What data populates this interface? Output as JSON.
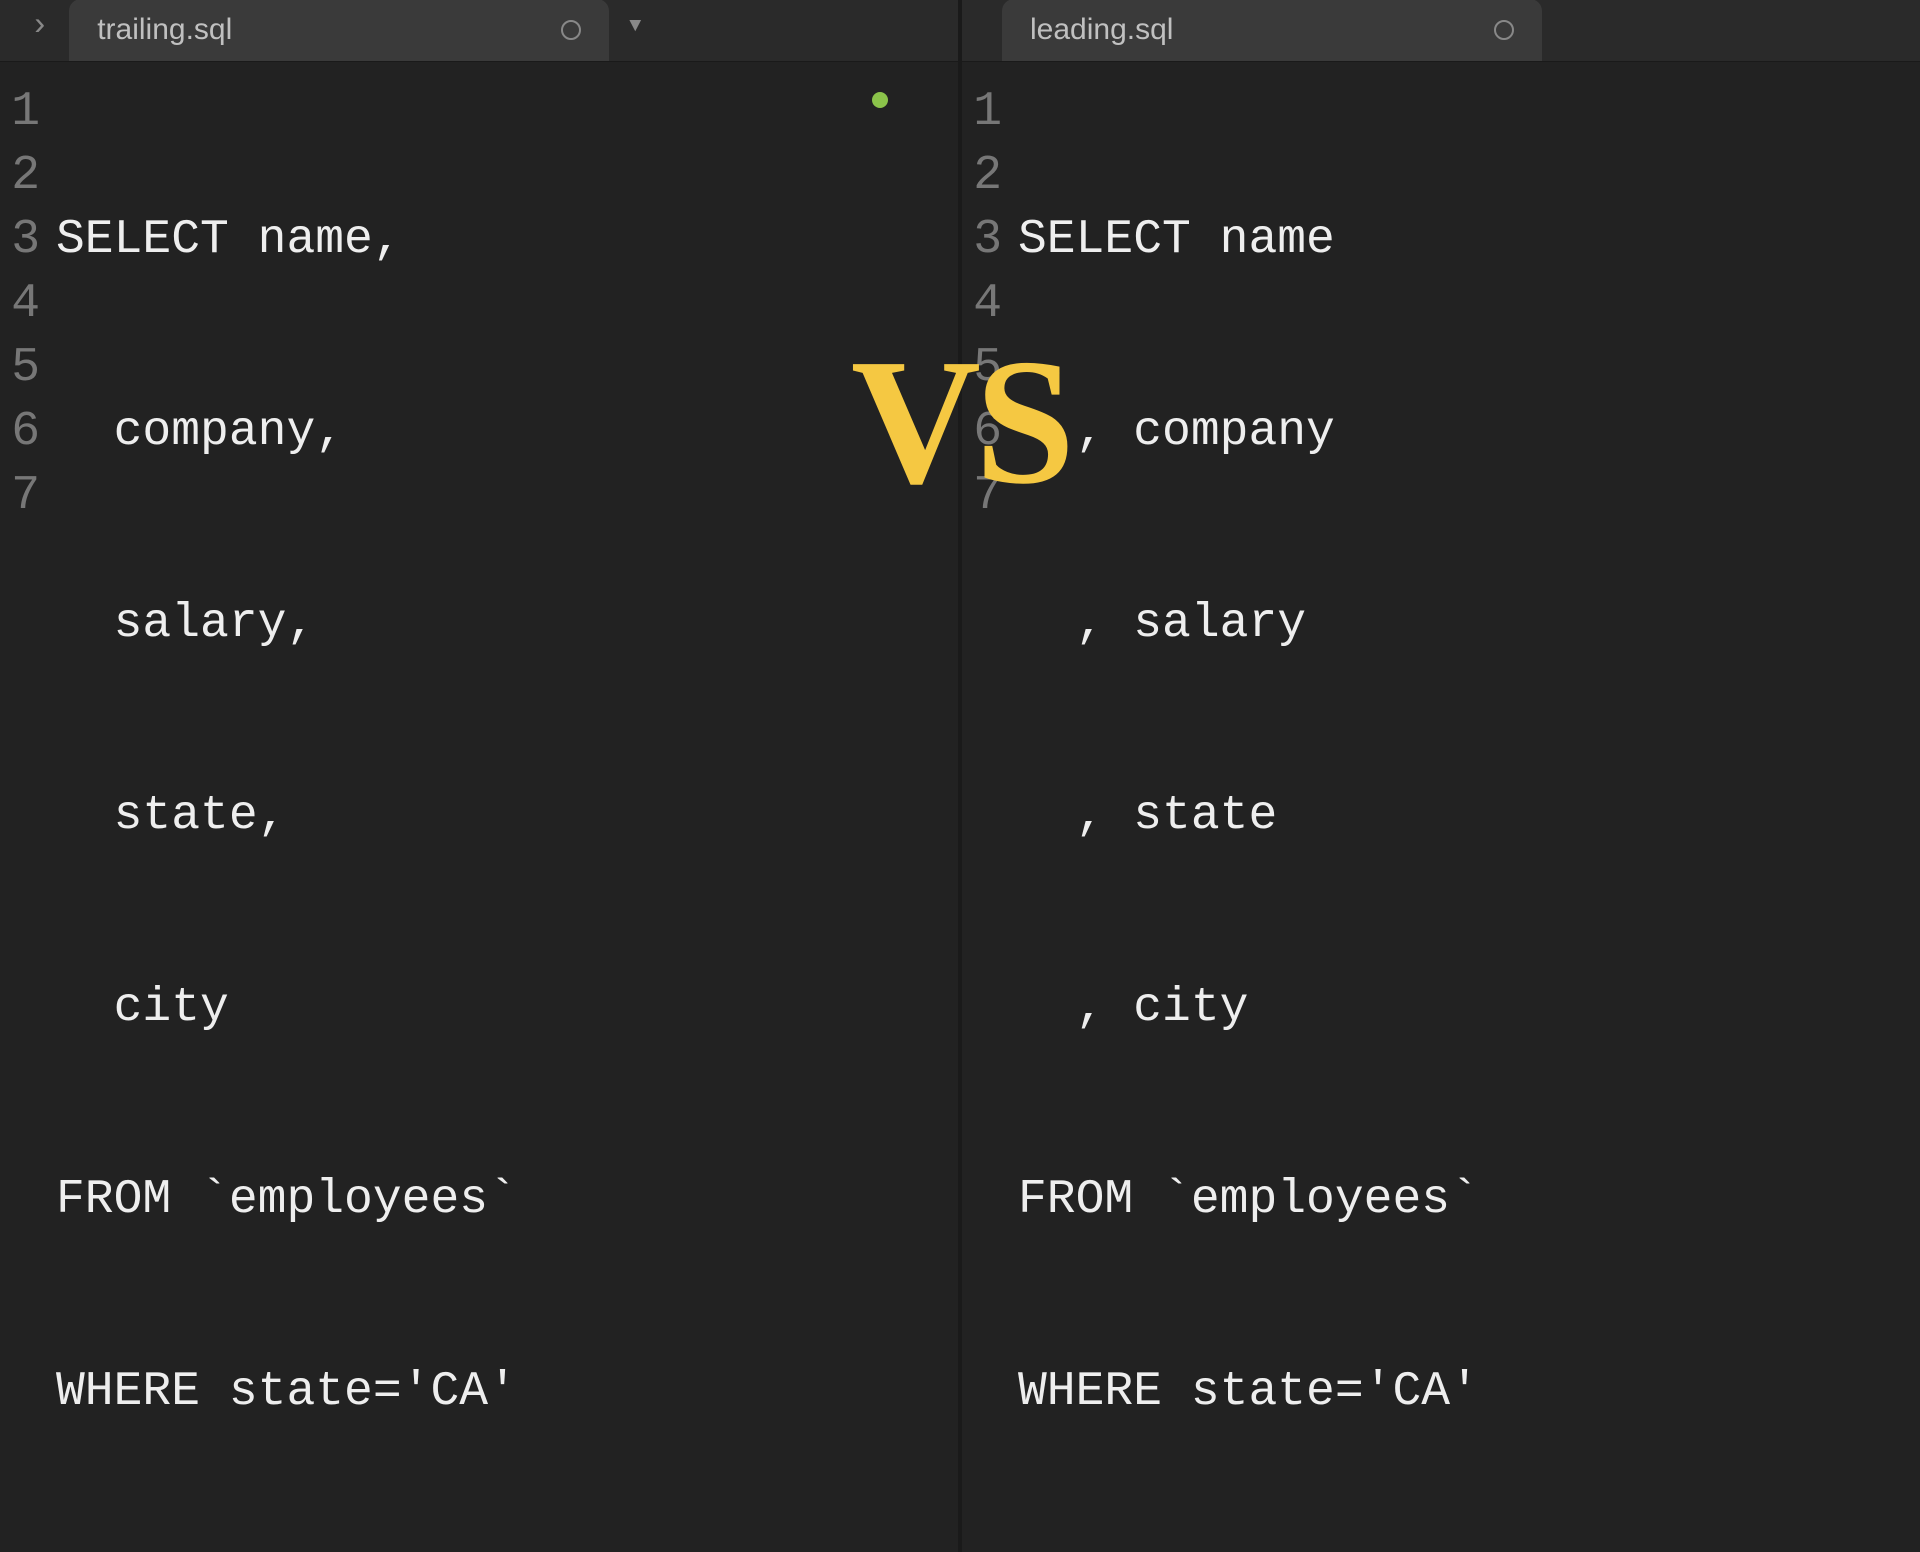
{
  "left": {
    "tab_name": "trailing.sql",
    "lines": [
      "SELECT name,",
      "  company,",
      "  salary,",
      "  state,",
      "  city",
      "FROM `employees`",
      "WHERE state='CA'"
    ],
    "modified": true
  },
  "right": {
    "tab_name": "leading.sql",
    "lines": [
      "SELECT name",
      "  , company",
      "  , salary",
      "  , state",
      "  , city",
      "FROM `employees`",
      "WHERE state='CA'"
    ],
    "modified": false
  },
  "vs_label": "VS",
  "line_numbers": [
    "1",
    "2",
    "3",
    "4",
    "5",
    "6",
    "7"
  ],
  "icons": {
    "arrow": "›",
    "dropdown": "▼"
  }
}
